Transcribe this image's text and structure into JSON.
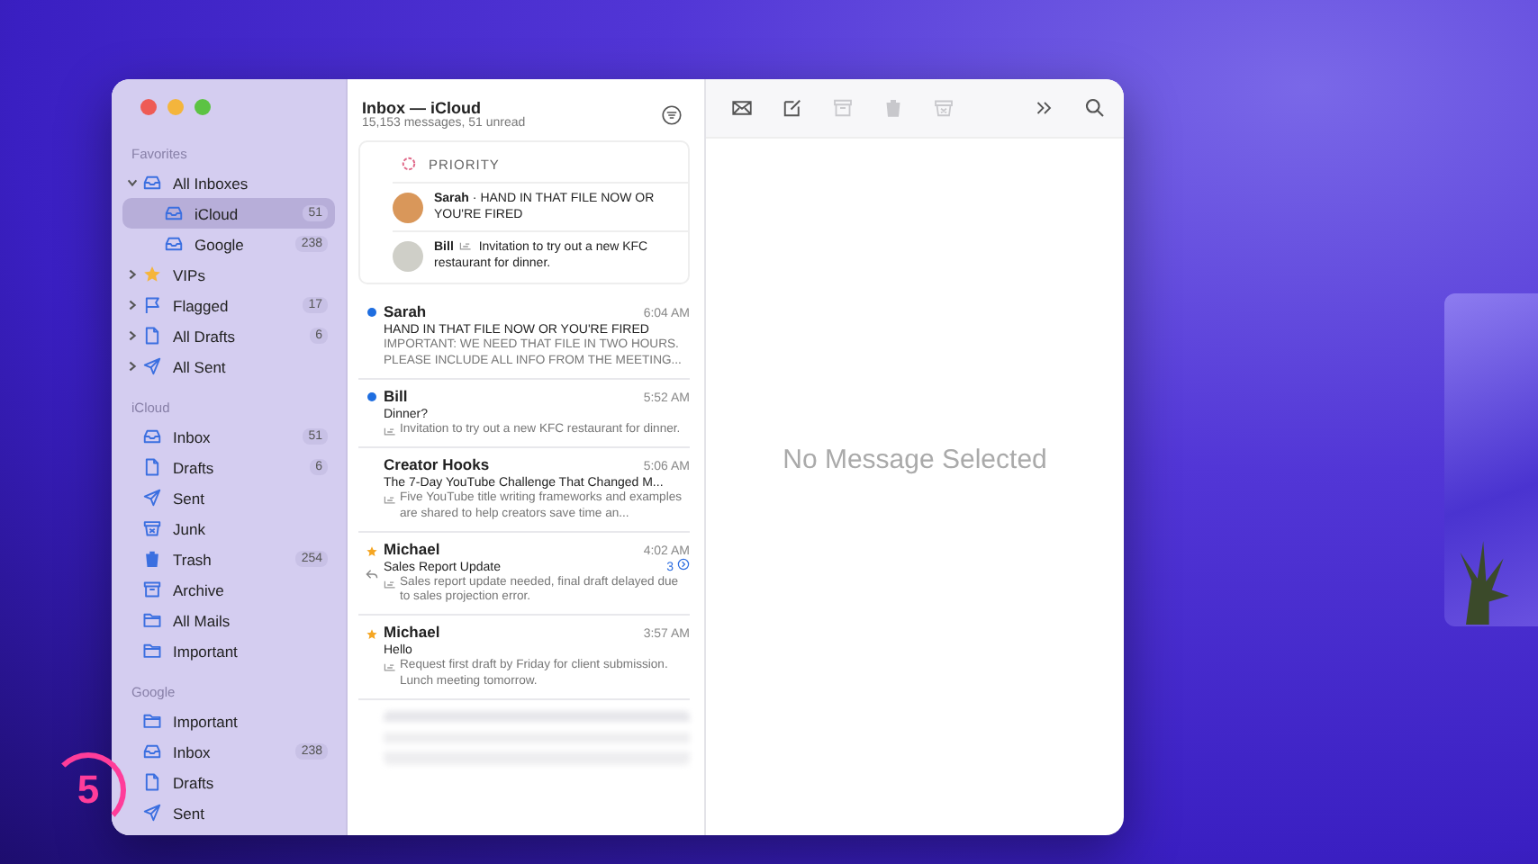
{
  "sidebar": {
    "sections": [
      {
        "title": "Favorites",
        "items": [
          {
            "label": "All Inboxes",
            "kind": "inbox",
            "expanded": true,
            "selected": false,
            "children": [
              {
                "label": "iCloud",
                "kind": "inbox",
                "count": "51",
                "selected": true
              },
              {
                "label": "Google",
                "kind": "inbox",
                "count": "238",
                "selected": false
              }
            ]
          },
          {
            "label": "VIPs",
            "kind": "star",
            "expanded": false,
            "selected": false
          },
          {
            "label": "Flagged",
            "kind": "flag",
            "expanded": false,
            "count": "17",
            "selected": false
          },
          {
            "label": "All Drafts",
            "kind": "drafts",
            "expanded": false,
            "count": "6",
            "selected": false
          },
          {
            "label": "All Sent",
            "kind": "sent",
            "expanded": false,
            "selected": false
          }
        ]
      },
      {
        "title": "iCloud",
        "items": [
          {
            "label": "Inbox",
            "kind": "inbox",
            "count": "51",
            "selected": false
          },
          {
            "label": "Drafts",
            "kind": "drafts",
            "count": "6",
            "selected": false
          },
          {
            "label": "Sent",
            "kind": "sent",
            "selected": false
          },
          {
            "label": "Junk",
            "kind": "junk",
            "selected": false
          },
          {
            "label": "Trash",
            "kind": "trash",
            "count": "254",
            "selected": false
          },
          {
            "label": "Archive",
            "kind": "archive",
            "selected": false
          },
          {
            "label": "All Mails",
            "kind": "folder",
            "selected": false
          },
          {
            "label": "Important",
            "kind": "folder",
            "selected": false
          }
        ]
      },
      {
        "title": "Google",
        "items": [
          {
            "label": "Important",
            "kind": "folder",
            "selected": false
          },
          {
            "label": "Inbox",
            "kind": "inbox",
            "count": "238",
            "selected": false
          },
          {
            "label": "Drafts",
            "kind": "drafts",
            "selected": false
          },
          {
            "label": "Sent",
            "kind": "sent",
            "selected": false
          }
        ]
      }
    ]
  },
  "mailbox": {
    "title": "Inbox — iCloud",
    "subtitle": "15,153 messages, 51 unread"
  },
  "priority": {
    "title": "PRIORITY",
    "items": [
      {
        "sender": "Sarah",
        "text": " · HAND IN THAT FILE NOW OR YOU'RE FIRED",
        "summary": false
      },
      {
        "sender": "Bill",
        "text": " Invitation to try out a new KFC restaurant for dinner.",
        "summary": true
      }
    ]
  },
  "messages": [
    {
      "sender": "Sarah",
      "time": "6:04 AM",
      "subject": "HAND IN THAT FILE NOW OR YOU'RE FIRED",
      "preview": "IMPORTANT: WE NEED THAT FILE IN TWO HOURS. PLEASE INCLUDE ALL INFO FROM THE MEETING...",
      "unread": true,
      "starred": false,
      "replied": false,
      "summary": false
    },
    {
      "sender": "Bill",
      "time": "5:52 AM",
      "subject": "Dinner?",
      "preview": "Invitation to try out a new KFC restaurant for dinner.",
      "unread": true,
      "starred": false,
      "replied": false,
      "summary": true
    },
    {
      "sender": "Creator Hooks",
      "time": "5:06 AM",
      "subject": "The 7-Day YouTube Challenge That Changed M...",
      "preview": "Five YouTube title writing frameworks and examples are shared to help creators save time an...",
      "unread": false,
      "starred": false,
      "replied": false,
      "summary": true
    },
    {
      "sender": "Michael",
      "time": "4:02 AM",
      "subject": "Sales Report Update",
      "preview": "Sales report update needed, final draft delayed due to sales projection error.",
      "unread": false,
      "starred": true,
      "replied": true,
      "thread_count": "3",
      "summary": true
    },
    {
      "sender": "Michael",
      "time": "3:57 AM",
      "subject": "Hello",
      "preview": "Request first draft by Friday for client submission. Lunch meeting tomorrow.",
      "unread": false,
      "starred": true,
      "replied": false,
      "summary": true
    }
  ],
  "toolbar": [
    {
      "kind": "envelope",
      "disabled": false
    },
    {
      "kind": "compose",
      "disabled": false
    },
    {
      "kind": "archive",
      "disabled": true
    },
    {
      "kind": "trash",
      "disabled": true
    },
    {
      "kind": "junk",
      "disabled": true
    },
    {
      "kind": "more",
      "disabled": false
    },
    {
      "kind": "search",
      "disabled": false
    }
  ],
  "viewer": {
    "empty_text": "No Message Selected"
  },
  "logo": {
    "text": "5"
  }
}
